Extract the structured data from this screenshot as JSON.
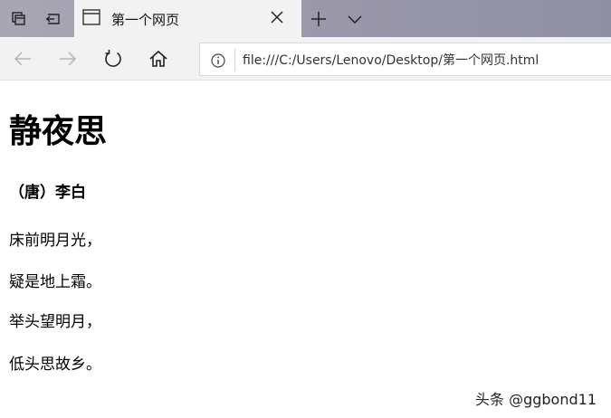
{
  "browser": {
    "tab": {
      "title": "第一个网页"
    },
    "address_bar": {
      "url": "file:///C:/Users/Lenovo/Desktop/第一个网页.html"
    }
  },
  "page": {
    "heading": "静夜思",
    "author": "（唐）李白",
    "lines": [
      "床前明月光，",
      "疑是地上霜。",
      "举头望明月，",
      "低头思故乡。"
    ]
  },
  "watermark": "头条 @ggbond11",
  "icons": {
    "tab_strip": [
      "tab-actions-icon",
      "set-aside-tabs-icon"
    ],
    "tab": [
      "page-icon",
      "close-icon"
    ],
    "tab_bar": [
      "plus-icon",
      "chevron-down-icon"
    ],
    "nav": [
      "back-arrow-icon",
      "forward-arrow-icon",
      "refresh-icon",
      "home-icon",
      "info-icon"
    ]
  },
  "colors": {
    "tab_strip_bg": "#9c9aab",
    "toolbar_bg": "#f2f2f2",
    "text": "#000000"
  }
}
